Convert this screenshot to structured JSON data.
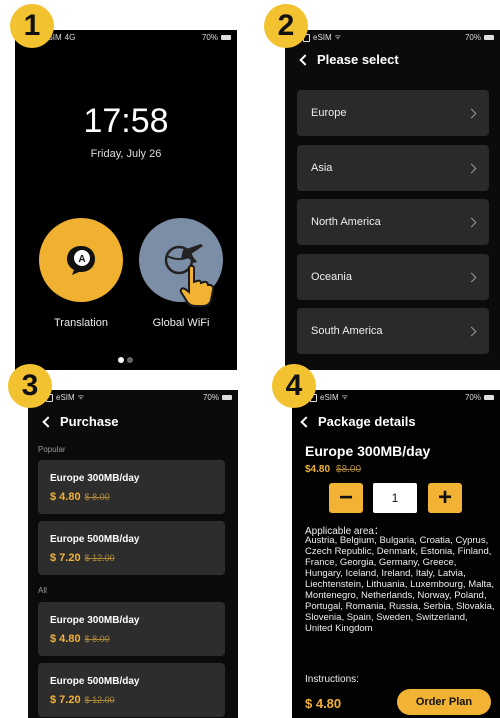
{
  "badges": [
    "1",
    "2",
    "3",
    "4"
  ],
  "status": {
    "sim": "eSIM",
    "network": "4G",
    "battery": "70%"
  },
  "lock": {
    "time": "17:58",
    "date": "Friday, July 26",
    "apps": [
      {
        "label": "Translation",
        "glyph": "A",
        "color": "#F0B030"
      },
      {
        "label": "Global WiFi",
        "color": "#7C8EA6"
      }
    ]
  },
  "region_select": {
    "title": "Please select",
    "regions": [
      "Europe",
      "Asia",
      "North America",
      "Oceania",
      "South America"
    ]
  },
  "purchase": {
    "title": "Purchase",
    "popular_label": "Popular",
    "all_label": "All",
    "popular": [
      {
        "name": "Europe 300MB/day",
        "price": "$ 4.80",
        "old_price": "$ 8.00"
      },
      {
        "name": "Europe 500MB/day",
        "price": "$ 7.20",
        "old_price": "$ 12.00"
      }
    ],
    "all": [
      {
        "name": "Europe 300MB/day",
        "price": "$ 4.80",
        "old_price": "$ 8.00"
      },
      {
        "name": "Europe 500MB/day",
        "price": "$ 7.20",
        "old_price": "$ 12.00"
      }
    ]
  },
  "details": {
    "title": "Package details",
    "plan_name": "Europe 300MB/day",
    "price": "$4.80",
    "old_price": "$8.00",
    "minus": "−",
    "plus": "+",
    "quantity": "1",
    "area_label": "Applicable area：",
    "area_text": "Austria, Belgium, Bulgaria, Croatia, Cyprus, Czech Republic, Denmark, Estonia, Finland, France, Georgia, Germany, Greece, Hungary, Iceland, Ireland, Italy, Latvia, Liechtenstein, Lithuania, Luxembourg, Malta, Montenegro, Netherlands, Norway, Poland, Portugal, Romania, Russia, Serbia, Slovakia, Slovenia, Spain, Sweden, Switzerland, United Kingdom",
    "instructions_label": "Instructions:",
    "total": "$ 4.80",
    "order_label": "Order Plan"
  },
  "colors": {
    "accent": "#F2B233",
    "card": "#2D2D2D",
    "background": "#000000"
  }
}
